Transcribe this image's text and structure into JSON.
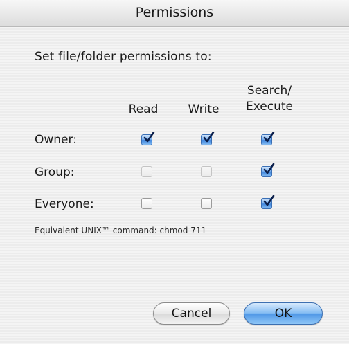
{
  "window": {
    "title": "Permissions"
  },
  "heading": "Set file/folder permissions to:",
  "columns": {
    "read": "Read",
    "write": "Write",
    "search_line1": "Search/",
    "search_line2": "Execute"
  },
  "rows": {
    "owner": {
      "label": "Owner:",
      "read": true,
      "write": true,
      "execute": true
    },
    "group": {
      "label": "Group:",
      "read": false,
      "write": false,
      "execute": true
    },
    "everyone": {
      "label": "Everyone:",
      "read": false,
      "write": false,
      "execute": true
    }
  },
  "unix_command": "Equivalent UNIX™ command: chmod 711",
  "buttons": {
    "cancel": "Cancel",
    "ok": "OK"
  },
  "colors": {
    "accent": "#3f86de",
    "check": "#0a1e4a"
  },
  "icons": {
    "checked": "checkmark-icon"
  }
}
